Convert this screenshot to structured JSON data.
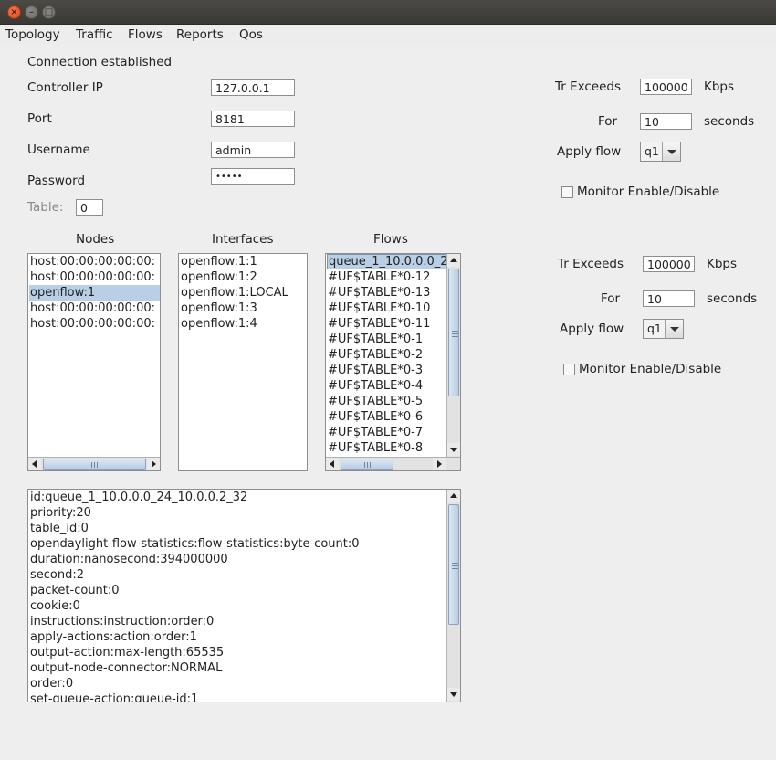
{
  "window": {
    "buttons": {
      "close": "×",
      "minimize": "–",
      "maximize": "□"
    }
  },
  "menu": [
    "Topology",
    "Traffic",
    "Flows",
    "Reports",
    "Qos"
  ],
  "connection": {
    "status": "Connection established",
    "controller_ip_label": "Controller IP",
    "controller_ip": "127.0.0.1",
    "port_label": "Port",
    "port": "8181",
    "username_label": "Username",
    "username": "admin",
    "password_label": "Password",
    "password_masked": "•••••",
    "table_label": "Table:",
    "table": "0"
  },
  "monitor_top": {
    "exceeds_label": "Tr Exceeds",
    "exceeds_value": "100000",
    "exceeds_unit": "Kbps",
    "for_label": "For",
    "for_value": "10",
    "for_unit": "seconds",
    "apply_label": "Apply flow",
    "apply_value": "q1",
    "monitor_label": "Monitor Enable/Disable",
    "monitor_checked": false
  },
  "monitor_bottom": {
    "exceeds_label": "Tr Exceeds",
    "exceeds_value": "100000",
    "exceeds_unit": "Kbps",
    "for_label": "For",
    "for_value": "10",
    "for_unit": "seconds",
    "apply_label": "Apply flow",
    "apply_value": "q1",
    "monitor_label": "Monitor Enable/Disable",
    "monitor_checked": false
  },
  "nodes": {
    "header": "Nodes",
    "items": [
      "host:00:00:00:00:00:",
      "host:00:00:00:00:00:",
      "openflow:1",
      "host:00:00:00:00:00:",
      "host:00:00:00:00:00:"
    ],
    "selected_index": 2
  },
  "interfaces": {
    "header": "Interfaces",
    "items": [
      "openflow:1:1",
      "openflow:1:2",
      "openflow:1:LOCAL",
      "openflow:1:3",
      "openflow:1:4"
    ]
  },
  "flows": {
    "header": "Flows",
    "items": [
      "queue_1_10.0.0.0_2",
      "#UF$TABLE*0-12",
      "#UF$TABLE*0-13",
      "#UF$TABLE*0-10",
      "#UF$TABLE*0-11",
      "#UF$TABLE*0-1",
      "#UF$TABLE*0-2",
      "#UF$TABLE*0-3",
      "#UF$TABLE*0-4",
      "#UF$TABLE*0-5",
      "#UF$TABLE*0-6",
      "#UF$TABLE*0-7",
      "#UF$TABLE*0-8"
    ],
    "selected_index": 0
  },
  "details": [
    "id:queue_1_10.0.0.0_24_10.0.0.2_32",
    "priority:20",
    "table_id:0",
    "opendaylight-flow-statistics:flow-statistics:byte-count:0",
    "duration:nanosecond:394000000",
    "second:2",
    "packet-count:0",
    "cookie:0",
    "instructions:instruction:order:0",
    "apply-actions:action:order:1",
    "output-action:max-length:65535",
    "output-node-connector:NORMAL",
    "order:0",
    "set-queue-action:queue-id:1"
  ]
}
